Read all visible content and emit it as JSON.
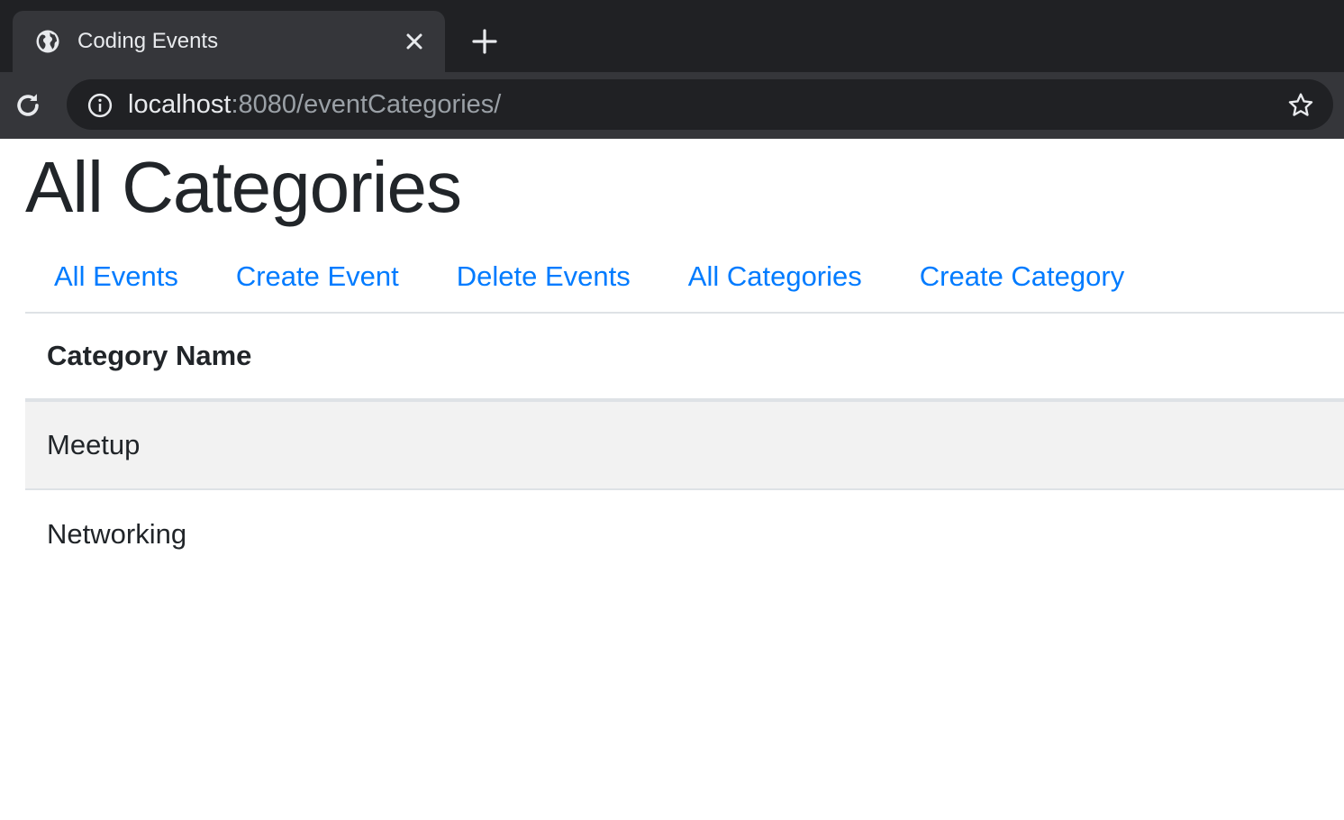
{
  "browser": {
    "tab_title": "Coding Events",
    "url_host": "localhost",
    "url_rest": ":8080/eventCategories/"
  },
  "page": {
    "title": "All Categories",
    "nav": [
      {
        "label": "All Events"
      },
      {
        "label": "Create Event"
      },
      {
        "label": "Delete Events"
      },
      {
        "label": "All Categories"
      },
      {
        "label": "Create Category"
      }
    ],
    "table": {
      "header": "Category Name",
      "rows": [
        "Meetup",
        "Networking"
      ]
    }
  },
  "colors": {
    "link": "#007bff",
    "text": "#212529",
    "chrome_dark": "#202124",
    "chrome_tab": "#35363a",
    "stripe": "#f2f2f2"
  }
}
